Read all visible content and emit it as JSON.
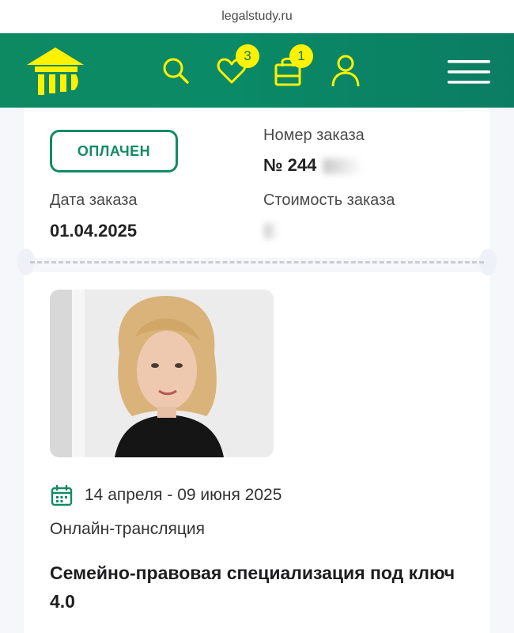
{
  "browser": {
    "url": "legalstudy.ru"
  },
  "header": {
    "logo_icon": "academy-columns-logo",
    "icons": [
      "search-icon",
      "heart-icon",
      "bag-icon",
      "user-icon",
      "menu-icon"
    ],
    "favorites_count": "3",
    "cart_count": "1",
    "brand_color": "#0e8a62",
    "accent_color": "#fff200"
  },
  "order": {
    "status": "ОПЛАЧЕН",
    "number_label": "Номер заказа",
    "number_value": "№ 244",
    "date_label": "Дата заказа",
    "date_value": "01.04.2025",
    "cost_label": "Стоимость заказа"
  },
  "course": {
    "dates": "14 апреля - 09 июня 2025",
    "format": "Онлайн-трансляция",
    "title": "Семейно-правовая специализация под ключ 4.0"
  }
}
